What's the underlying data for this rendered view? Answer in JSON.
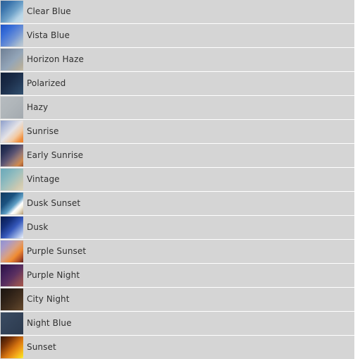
{
  "list": {
    "name": "gradient-preset-list",
    "background": "#ffffff",
    "row_background": "#d5d5d5",
    "text_color": "#303030",
    "items": [
      {
        "label": "Clear Blue",
        "swatch_name": "gradient-swatch-clear-blue",
        "gradient": "linear-gradient(135deg, #2d6095 0%, #3a74ac 25%, #6fa2c9 55%, #b6d4e6 78%, #cfe0ea 100%)",
        "colors": [
          "#2d6095",
          "#6fa2c9",
          "#cfe0ea"
        ]
      },
      {
        "label": "Vista Blue",
        "swatch_name": "gradient-swatch-vista-blue",
        "gradient": "linear-gradient(135deg, #1d53c8 0%, #3a6fd8 30%, #6f93d6 60%, #a9bdd0 85%, #c3ccd4 100%)",
        "colors": [
          "#1d53c8",
          "#6f93d6",
          "#c3ccd4"
        ]
      },
      {
        "label": "Horizon Haze",
        "swatch_name": "gradient-swatch-horizon-haze",
        "gradient": "linear-gradient(135deg, #6d7f94 0%, #7f90a5 25%, #93a5b8 55%, #b2ad9e 85%, #c5bca6 100%)",
        "colors": [
          "#6d7f94",
          "#93a5b8",
          "#c5bca6"
        ]
      },
      {
        "label": "Polarized",
        "swatch_name": "gradient-swatch-polarized",
        "gradient": "linear-gradient(135deg, #111f38 0%, #1a2b47 40%, #27405e 75%, #32506f 100%)",
        "colors": [
          "#111f38",
          "#27405e",
          "#32506f"
        ]
      },
      {
        "label": "Hazy",
        "swatch_name": "gradient-swatch-hazy",
        "gradient": "linear-gradient(135deg, #b6bbbf 0%, #b0b6ba 45%, #a8aeb3 80%, #a4aaaf 100%)",
        "colors": [
          "#b6bbbf",
          "#a8aeb3"
        ]
      },
      {
        "label": "Sunrise",
        "swatch_name": "gradient-swatch-sunrise",
        "gradient": "linear-gradient(135deg, #8e9ec9 0%, #b3bedb 22%, #e4e2e6 48%, #f3c9a0 70%, #f09040 88%, #ef7f26 100%)",
        "colors": [
          "#8e9ec9",
          "#e4e2e6",
          "#ef7f26"
        ]
      },
      {
        "label": "Early Sunrise",
        "swatch_name": "gradient-swatch-early-sunrise",
        "gradient": "linear-gradient(135deg, #132042 0%, #2c3357 25%, #5b5473 48%, #9b7b73 68%, #d08a4c 85%, #a0512c 100%)",
        "colors": [
          "#132042",
          "#5b5473",
          "#d08a4c",
          "#a0512c"
        ]
      },
      {
        "label": "Vintage",
        "swatch_name": "gradient-swatch-vintage",
        "gradient": "linear-gradient(135deg, #6aa8b8 0%, #7eb3bd 25%, #9dc0be 50%, #cdc9b0 80%, #e0d6bc 100%)",
        "colors": [
          "#6aa8b8",
          "#9dc0be",
          "#e0d6bc"
        ]
      },
      {
        "label": "Dusk Sunset",
        "swatch_name": "gradient-swatch-dusk-sunset",
        "gradient": "linear-gradient(135deg, #12395f 0%, #1b5280 35%, #5e9ec4 58%, #ffffff 72%, #f6f2e4 80%, #b39a72 100%)",
        "colors": [
          "#12395f",
          "#5e9ec4",
          "#ffffff",
          "#b39a72"
        ]
      },
      {
        "label": "Dusk",
        "swatch_name": "gradient-swatch-dusk",
        "gradient": "linear-gradient(135deg, #081a4b 0%, #15307c 30%, #3558bb 55%, #8fa8e0 78%, #f2f4fa 100%)",
        "colors": [
          "#081a4b",
          "#3558bb",
          "#f2f4fa"
        ]
      },
      {
        "label": "Purple Sunset",
        "swatch_name": "gradient-swatch-purple-sunset",
        "gradient": "linear-gradient(135deg, #8e91d0 0%, #a99ac8 22%, #d9a082 48%, #ef8b33 68%, #b24f26 86%, #5d1f1c 100%)",
        "colors": [
          "#8e91d0",
          "#ef8b33",
          "#5d1f1c"
        ]
      },
      {
        "label": "Purple Night",
        "swatch_name": "gradient-swatch-purple-night",
        "gradient": "linear-gradient(135deg, #2b1040 0%, #42215a 30%, #5c3160 55%, #8a4c55 80%, #a8564c 100%)",
        "colors": [
          "#2b1040",
          "#5c3160",
          "#a8564c"
        ]
      },
      {
        "label": "City Night",
        "swatch_name": "gradient-swatch-city-night",
        "gradient": "linear-gradient(135deg, #1b1511 0%, #2b1f16 30%, #43301f 62%, #5b4229 88%, #654a2e 100%)",
        "colors": [
          "#1b1511",
          "#43301f",
          "#654a2e"
        ]
      },
      {
        "label": "Night Blue",
        "swatch_name": "gradient-swatch-night-blue",
        "gradient": "linear-gradient(135deg, #3a4b61 0%, #35455b 35%, #303f54 70%, #2c3a4e 100%)",
        "colors": [
          "#3a4b61",
          "#303f54",
          "#2c3a4e"
        ]
      },
      {
        "label": "Sunset",
        "swatch_name": "gradient-swatch-sunset",
        "gradient": "linear-gradient(135deg, #2e1405 0%, #7a3408 28%, #d4720f 55%, #f2a41a 75%, #f7d51e 92%, #fdf24a 100%)",
        "colors": [
          "#2e1405",
          "#d4720f",
          "#f7d51e",
          "#fdf24a"
        ]
      }
    ]
  }
}
